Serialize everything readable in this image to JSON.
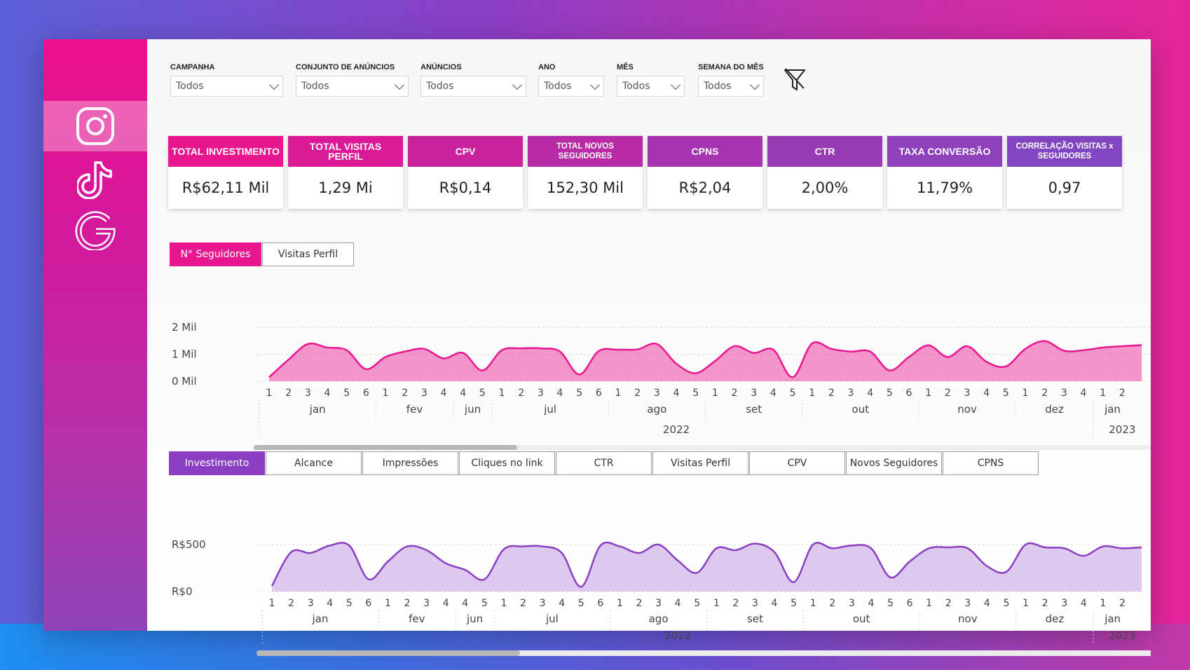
{
  "filters": [
    {
      "label": "CAMPANHA",
      "value": "Todos"
    },
    {
      "label": "CONJUNTO DE ANÚNCIOS",
      "value": "Todos"
    },
    {
      "label": "ANÚNCIOS",
      "value": "Todos"
    },
    {
      "label": "ANO",
      "value": "Todos"
    },
    {
      "label": "MÊS",
      "value": "Todos"
    },
    {
      "label": "SEMANA DO MÊS",
      "value": "Todos"
    }
  ],
  "sidebar": {
    "items": [
      {
        "icon": "instagram-icon",
        "active": true
      },
      {
        "icon": "tiktok-icon",
        "active": false
      },
      {
        "icon": "google-icon",
        "active": false
      }
    ]
  },
  "kpis": [
    {
      "title": "TOTAL INVESTIMENTO",
      "value": "R$62,11 Mil",
      "color": "#e8168f"
    },
    {
      "title": "TOTAL VISITAS PERFIL",
      "value": "1,29 Mi",
      "color": "#da1a96"
    },
    {
      "title": "CPV",
      "value": "R$0,14",
      "color": "#c8229d"
    },
    {
      "title": "TOTAL NOVOS SEGUIDORES",
      "value": "152,30 Mil",
      "color": "#b82aa6"
    },
    {
      "title": "CPNS",
      "value": "R$2,04",
      "color": "#a633b0"
    },
    {
      "title": "CTR",
      "value": "2,00%",
      "color": "#9a3bb6"
    },
    {
      "title": "TAXA CONVERSÃO",
      "value": "11,79%",
      "color": "#8f41bc"
    },
    {
      "title": "CORRELAÇÃO VISITAS x SEGUIDORES",
      "value": "0,97",
      "color": "#8346c2"
    }
  ],
  "tabs1": [
    {
      "label": "N° Seguidores",
      "active": true
    },
    {
      "label": "Visitas Perfil",
      "active": false
    }
  ],
  "tabs2": [
    {
      "label": "Investimento",
      "active": true
    },
    {
      "label": "Alcance",
      "active": false
    },
    {
      "label": "Impressões",
      "active": false
    },
    {
      "label": "Cliques no link",
      "active": false
    },
    {
      "label": "CTR",
      "active": false
    },
    {
      "label": "Visitas Perfil",
      "active": false
    },
    {
      "label": "CPV",
      "active": false
    },
    {
      "label": "Novos Seguidores",
      "active": false
    },
    {
      "label": "CPNS",
      "active": false
    }
  ],
  "chart_data": [
    {
      "type": "area",
      "y_ticks": [
        "2 Mil",
        "1 Mil",
        "0 Mil"
      ],
      "ylim": [
        0,
        2000
      ],
      "color": "#e8168f",
      "x_groups": [
        {
          "month": "jan",
          "weeks": [
            "1",
            "2",
            "3",
            "4",
            "5",
            "6"
          ],
          "year": "2022"
        },
        {
          "month": "fev",
          "weeks": [
            "1",
            "2",
            "3",
            "4"
          ],
          "year": "2022"
        },
        {
          "month": "jun",
          "weeks": [
            "4",
            "5"
          ],
          "year": "2022"
        },
        {
          "month": "jul",
          "weeks": [
            "1",
            "2",
            "3",
            "4",
            "5",
            "6"
          ],
          "year": "2022"
        },
        {
          "month": "ago",
          "weeks": [
            "1",
            "2",
            "3",
            "4",
            "5"
          ],
          "year": "2022"
        },
        {
          "month": "set",
          "weeks": [
            "1",
            "2",
            "3",
            "4",
            "5"
          ],
          "year": "2022"
        },
        {
          "month": "out",
          "weeks": [
            "1",
            "2",
            "3",
            "4",
            "5",
            "6"
          ],
          "year": "2022"
        },
        {
          "month": "nov",
          "weeks": [
            "1",
            "2",
            "3",
            "4",
            "5"
          ],
          "year": "2022"
        },
        {
          "month": "dez",
          "weeks": [
            "1",
            "2",
            "3",
            "4"
          ],
          "year": "2022"
        },
        {
          "month": "jan",
          "weeks": [
            "1",
            "2"
          ],
          "year": "2023"
        }
      ],
      "years": [
        "2022",
        "2023"
      ],
      "values": [
        150,
        800,
        1380,
        1250,
        1150,
        450,
        900,
        1100,
        1200,
        850,
        1050,
        400,
        1150,
        1220,
        1220,
        1100,
        250,
        1120,
        1170,
        1180,
        1380,
        650,
        300,
        750,
        1300,
        1050,
        1170,
        150,
        1400,
        1200,
        1100,
        1100,
        400,
        900,
        1330,
        900,
        1300,
        720,
        550,
        1200,
        1490,
        1130,
        1150,
        1250,
        1300,
        1340
      ]
    },
    {
      "type": "area",
      "y_ticks": [
        "R$500",
        "R$0"
      ],
      "ylim": [
        0,
        500
      ],
      "color": "#8a3fc2",
      "x_groups": [
        {
          "month": "jan",
          "weeks": [
            "1",
            "2",
            "3",
            "4",
            "5",
            "6"
          ],
          "year": "2022"
        },
        {
          "month": "fev",
          "weeks": [
            "1",
            "2",
            "3",
            "4"
          ],
          "year": "2022"
        },
        {
          "month": "jun",
          "weeks": [
            "4",
            "5"
          ],
          "year": "2022"
        },
        {
          "month": "jul",
          "weeks": [
            "1",
            "2",
            "3",
            "4",
            "5",
            "6"
          ],
          "year": "2022"
        },
        {
          "month": "ago",
          "weeks": [
            "1",
            "2",
            "3",
            "4",
            "5"
          ],
          "year": "2022"
        },
        {
          "month": "set",
          "weeks": [
            "1",
            "2",
            "3",
            "4",
            "5"
          ],
          "year": "2022"
        },
        {
          "month": "out",
          "weeks": [
            "1",
            "2",
            "3",
            "4",
            "5",
            "6"
          ],
          "year": "2022"
        },
        {
          "month": "nov",
          "weeks": [
            "1",
            "2",
            "3",
            "4",
            "5"
          ],
          "year": "2022"
        },
        {
          "month": "dez",
          "weeks": [
            "1",
            "2",
            "3",
            "4"
          ],
          "year": "2022"
        },
        {
          "month": "jan",
          "weeks": [
            "1",
            "2"
          ],
          "year": "2023"
        }
      ],
      "years": [
        "2022",
        "2023"
      ],
      "values": [
        60,
        420,
        410,
        490,
        490,
        130,
        320,
        480,
        440,
        300,
        230,
        130,
        450,
        480,
        480,
        410,
        50,
        490,
        480,
        410,
        500,
        330,
        200,
        460,
        440,
        510,
        420,
        100,
        500,
        460,
        490,
        460,
        150,
        320,
        460,
        470,
        460,
        270,
        210,
        500,
        470,
        460,
        380,
        480,
        460,
        470
      ]
    }
  ]
}
